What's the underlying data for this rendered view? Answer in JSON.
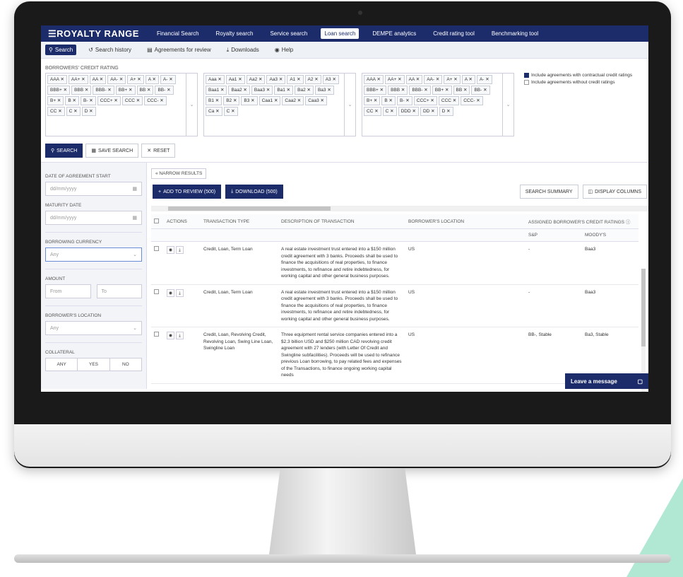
{
  "nav": {
    "logo": "☰ROYALTY RANGE",
    "links": [
      "Financial Search",
      "Royalty search",
      "Service search",
      "Loan search",
      "DEMPE analytics",
      "Credit rating tool",
      "Benchmarking tool"
    ]
  },
  "subnav": {
    "items": [
      "Search",
      "Search history",
      "Agreements for review",
      "Downloads",
      "Help"
    ]
  },
  "ratings": {
    "label": "BORROWERS' CREDIT RATING",
    "box1": [
      "AAA ✕",
      "AA+ ✕",
      "AA ✕",
      "AA- ✕",
      "A+ ✕",
      "A ✕",
      "A- ✕",
      "BBB+ ✕",
      "BBB ✕",
      "BBB- ✕",
      "BB+ ✕",
      "BB ✕",
      "BB- ✕",
      "B+ ✕",
      "B ✕",
      "B- ✕",
      "CCC+ ✕",
      "CCC ✕",
      "CCC- ✕",
      "CC ✕",
      "C ✕",
      "D ✕"
    ],
    "box2": [
      "Aaa ✕",
      "Aa1 ✕",
      "Aa2 ✕",
      "Aa3 ✕",
      "A1 ✕",
      "A2 ✕",
      "A3 ✕",
      "Baa1 ✕",
      "Baa2 ✕",
      "Baa3 ✕",
      "Ba1 ✕",
      "Ba2 ✕",
      "Ba3 ✕",
      "B1 ✕",
      "B2 ✕",
      "B3 ✕",
      "Caa1 ✕",
      "Caa2 ✕",
      "Caa3 ✕",
      "Ca ✕",
      "C ✕"
    ],
    "box3": [
      "AAA ✕",
      "AA+ ✕",
      "AA ✕",
      "AA- ✕",
      "A+ ✕",
      "A ✕",
      "A- ✕",
      "BBB+ ✕",
      "BBB ✕",
      "BBB- ✕",
      "BB+ ✕",
      "BB ✕",
      "BB- ✕",
      "B+ ✕",
      "B ✕",
      "B- ✕",
      "CCC+ ✕",
      "CCC ✕",
      "CCC- ✕",
      "CC ✕",
      "C ✕",
      "DDD ✕",
      "DD ✕",
      "D ✕"
    ],
    "check1": "Include agreements with contractual credit ratings",
    "check2": "Include agreements without credit ratings"
  },
  "actions": {
    "search": "SEARCH",
    "save": "SAVE SEARCH",
    "reset": "RESET"
  },
  "filters": {
    "date_start_label": "DATE OF AGREEMENT START",
    "date_placeholder": "dd/mm/yyyy",
    "maturity_label": "MATURITY DATE",
    "currency_label": "BORROWING CURRENCY",
    "currency_value": "Any",
    "amount_label": "AMOUNT",
    "amount_from": "From",
    "amount_to": "To",
    "location_label": "BORROWER'S LOCATION",
    "location_value": "Any",
    "collateral_label": "COLLATERAL",
    "collateral_options": [
      "ANY",
      "YES",
      "NO"
    ]
  },
  "results": {
    "narrow": "« NARROW RESULTS",
    "add_review": "ADD TO REVIEW (500)",
    "download": "DOWNLOAD (500)",
    "summary": "SEARCH SUMMARY",
    "columns": "DISPLAY COLUMNS",
    "headers": [
      "ACTIONS",
      "TRANSACTION TYPE",
      "DESCRIPTION OF TRANSACTION",
      "BORROWER'S LOCATION",
      "ASSIGNED BORROWER'S CREDIT RATINGS ⓘ",
      "S&P",
      "MOODY'S"
    ],
    "rows": [
      {
        "type": "Credit, Loan, Term Loan",
        "desc": "A real estate investment trust entered into a $150 million credit agreement with 3 banks. Proceeds shall be used to finance the acquisitions of real properties, to finance investments, to refinance and retire indebtedness, for working capital and other general business purposes.",
        "loc": "US",
        "sp": "-",
        "moodys": "Baa3"
      },
      {
        "type": "Credit, Loan, Term Loan",
        "desc": "A real estate investment trust entered into a $150 million credit agreement with 3 banks. Proceeds shall be used to finance the acquisitions of real properties, to finance investments, to refinance and retire indebtedness, for working capital and other general business purposes.",
        "loc": "US",
        "sp": "-",
        "moodys": "Baa3"
      },
      {
        "type": "Credit, Loan, Revolving Credit, Revolving Loan, Swing Line Loan, Swingline Loan",
        "desc": "Three equipment rental service companies entered into a $2.3 billion USD and $250 million CAD revolving credit agreement with 27 lenders (with Letter Of Credit and Swingline subfacilities). Proceeds will be used to refinance previous Loan borrowing, to pay related fees and expenses of the Transactions, to finance ongoing working capital needs",
        "loc": "US",
        "sp": "BB-, Stable",
        "moodys": "Ba3, Stable"
      }
    ]
  },
  "chat": {
    "label": "Leave a message"
  }
}
